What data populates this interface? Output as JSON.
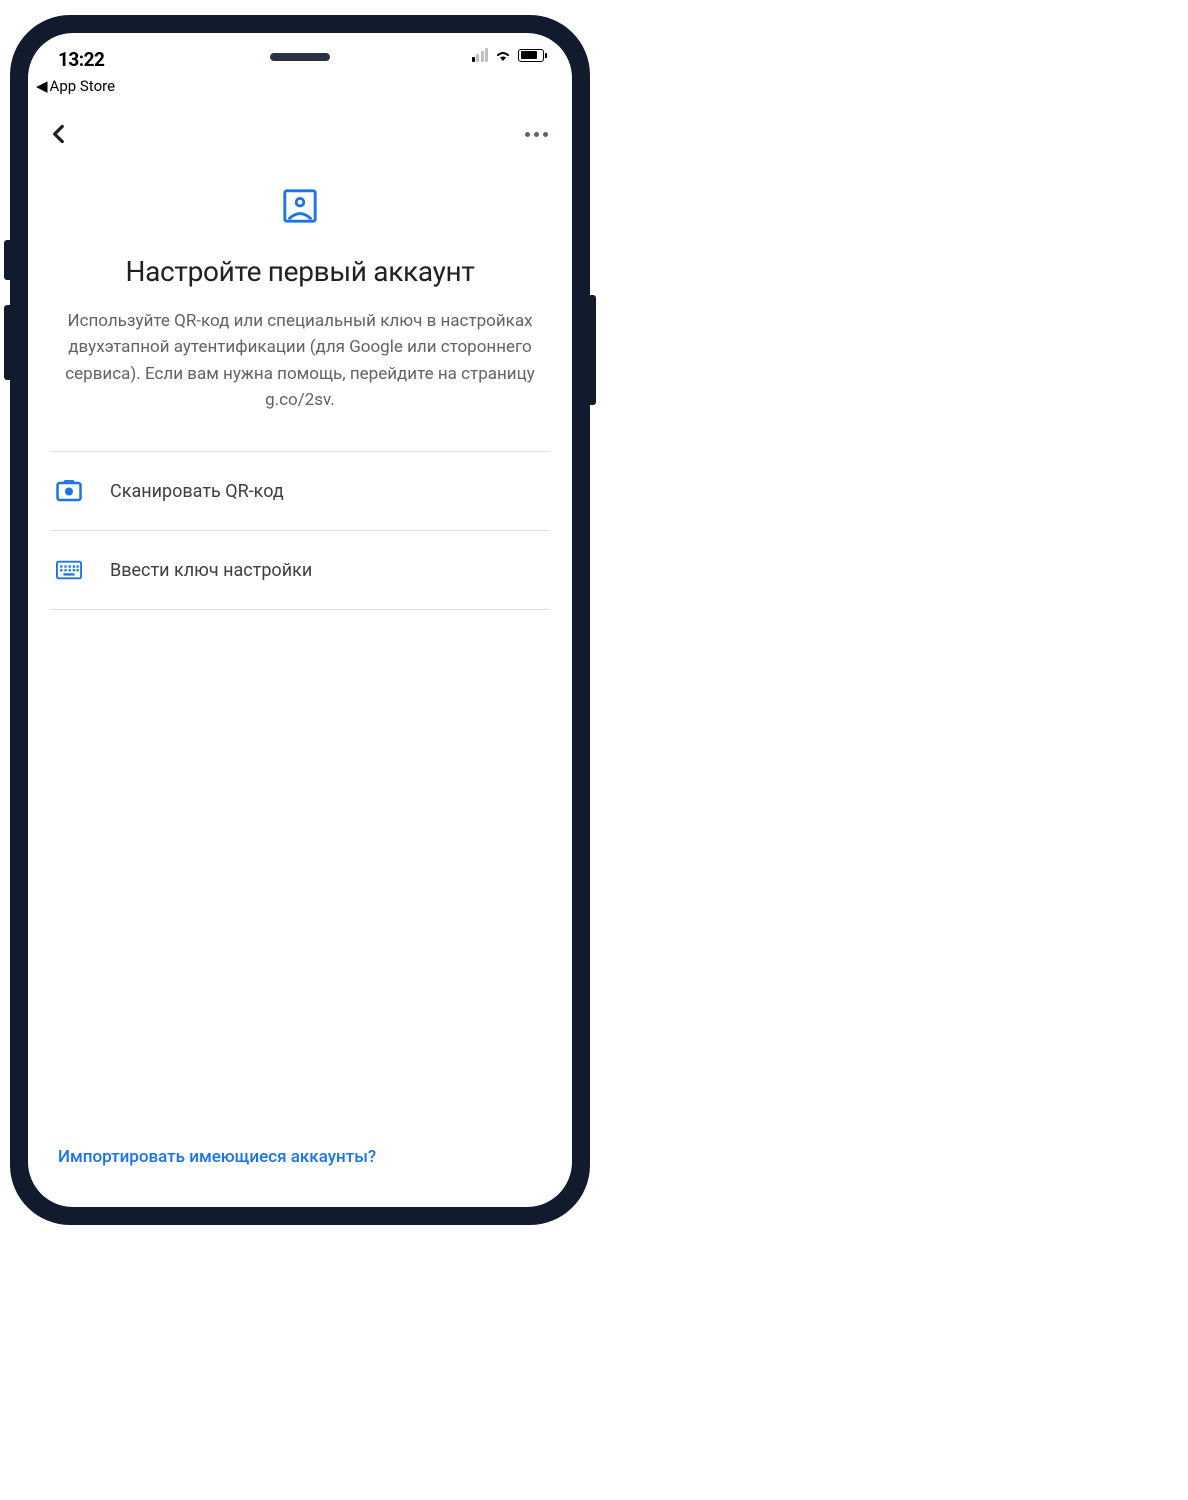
{
  "status_bar": {
    "time": "13:22",
    "back_to_app": "App Store"
  },
  "page": {
    "title": "Настройте первый аккаунт",
    "description": "Используйте QR-код или специальный ключ в настройках двухэтапной аутентификации (для Google или стороннего сервиса). Если вам нужна помощь, перейдите на страницу g.co/2sv."
  },
  "options": {
    "scan_qr": "Сканировать QR-код",
    "enter_key": "Ввести ключ настройки"
  },
  "footer": {
    "import_link": "Импортировать имеющиеся аккаунты?"
  },
  "colors": {
    "primary": "#1a73e8",
    "text_primary": "#202124",
    "text_secondary": "#5f6368"
  }
}
